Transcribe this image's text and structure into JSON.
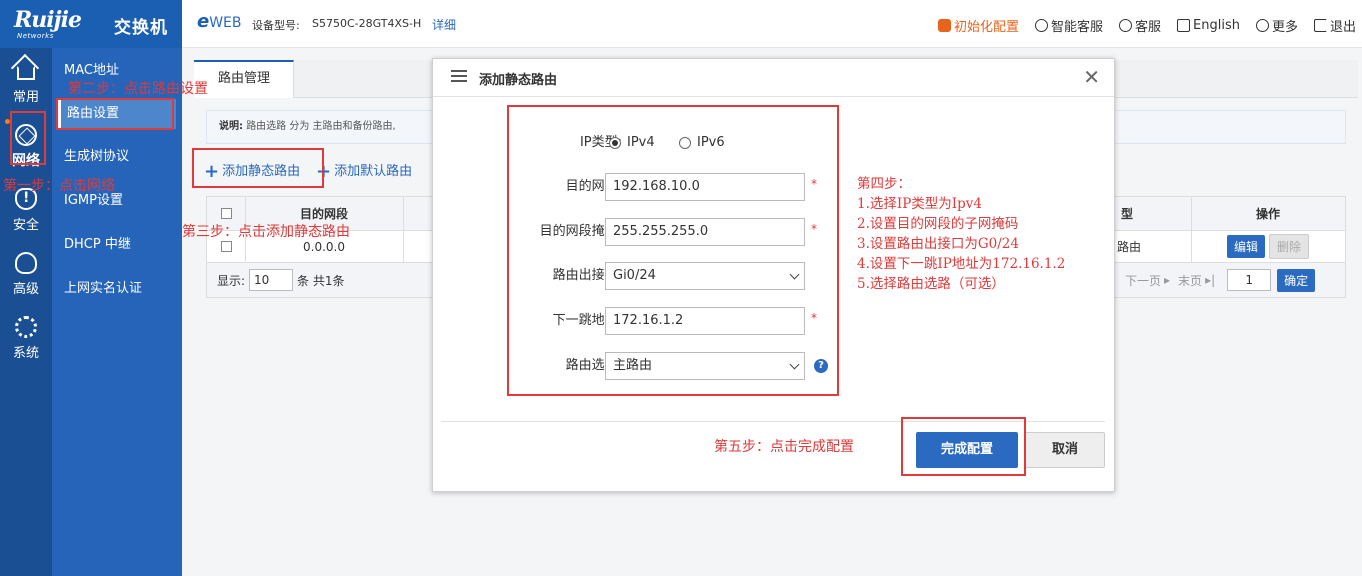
{
  "header": {
    "brand": "Ruijie",
    "brand_sub": "Networks",
    "product": "交换机",
    "eweb_e": "e",
    "eweb_web": "WEB",
    "model_label": "设备型号:",
    "model_value": "S5750C-28GT4XS-H",
    "detail_link": "详细",
    "actions": {
      "init": "初始化配置",
      "smart_service": "智能客服",
      "service": "客服",
      "language": "English",
      "more": "更多",
      "logout": "退出"
    },
    "colors": {
      "brand_blue": "#1b5fb3",
      "init_orange": "#e8641c"
    }
  },
  "icon_nav": {
    "common": "常用",
    "network": "网络",
    "security": "安全",
    "advanced": "高级",
    "system": "系统"
  },
  "sub_nav": {
    "mac": "MAC地址",
    "routing": "路由设置",
    "stp": "生成树协议",
    "igmp": "IGMP设置",
    "dhcp": "DHCP 中继",
    "realname": "上网实名认证"
  },
  "main": {
    "tab": "路由管理",
    "notice_label": "说明:",
    "notice_text": "路由选路 分为 主路由和备份路由,",
    "add_static": "添加静态路由",
    "add_default": "添加默认路由",
    "table": {
      "col_dest": "目的网段",
      "col_type_fragment": "型",
      "col_actions": "操作",
      "row_dest": "0.0.0.0",
      "row_type_fragment": "路由",
      "edit": "编辑",
      "delete": "删除"
    },
    "footer": {
      "show": "显示:",
      "page_size": "10",
      "count": "条 共1条",
      "next": "下一页",
      "last": "末页",
      "page": "1",
      "confirm": "确定"
    }
  },
  "modal": {
    "title": "添加静态路由",
    "ip_type_label": "IP类型:",
    "ipv4": "IPv4",
    "ipv6": "IPv6",
    "dest_label": "目的网段:",
    "dest_value": "192.168.10.0",
    "mask_label": "目的网段掩码:",
    "mask_value": "255.255.255.0",
    "iface_label": "路由出接口:",
    "iface_value": "Gi0/24",
    "nexthop_label": "下一跳地址:",
    "nexthop_value": "172.16.1.2",
    "route_sel_label": "路由选路:",
    "route_sel_value": "主路由",
    "required_mark": "*",
    "help": "?",
    "submit": "完成配置",
    "cancel": "取消"
  },
  "annotations": {
    "step1": "第一步：点击网络",
    "step2": "第二步：点击路由设置",
    "step3": "第三步：点击添加静态路由",
    "step4_title": "第四步：",
    "step4_items": [
      "1.选择IP类型为Ipv4",
      "2.设置目的网段的子网掩码",
      "3.设置路由出接口为G0/24",
      "4.设置下一跳IP地址为172.16.1.2",
      "5.选择路由选路（可选）"
    ],
    "step5": "第五步：点击完成配置",
    "color": "#e03a3a"
  }
}
